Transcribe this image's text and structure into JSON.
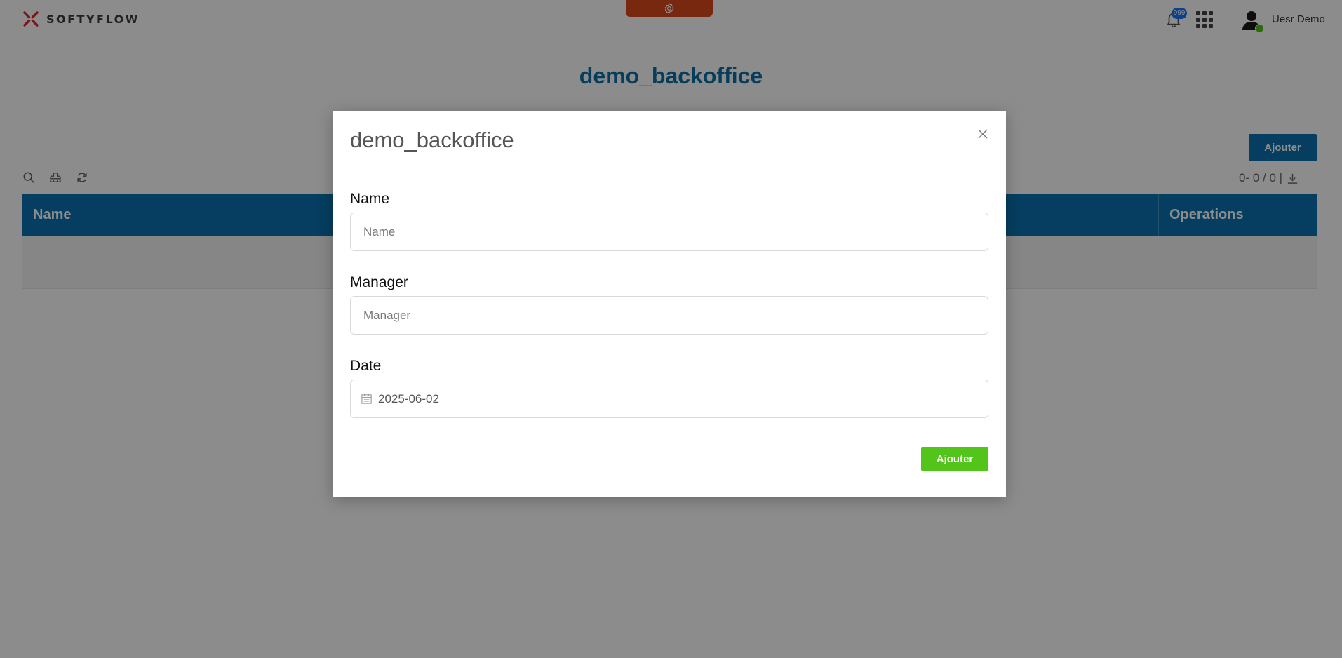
{
  "header": {
    "logo_text": "SOFTYFLOW",
    "notifications_badge": "999",
    "user_name": "Uesr Demo",
    "settings_color": "#d94a1c"
  },
  "page": {
    "title": "demo_backoffice",
    "add_button_label": "Ajouter",
    "pagination_text": "0- 0 / 0 |",
    "table": {
      "columns": [
        "Name",
        "Operations"
      ]
    }
  },
  "modal": {
    "title": "demo_backoffice",
    "fields": {
      "name": {
        "label": "Name",
        "placeholder": "Name"
      },
      "manager": {
        "label": "Manager",
        "placeholder": "Manager"
      },
      "date": {
        "label": "Date",
        "value": "2025-06-02"
      }
    },
    "submit_label": "Ajouter"
  },
  "colors": {
    "primary": "#0a72b0",
    "title": "#0b6fa4",
    "success": "#52c41a",
    "accent": "#d94a1c"
  }
}
